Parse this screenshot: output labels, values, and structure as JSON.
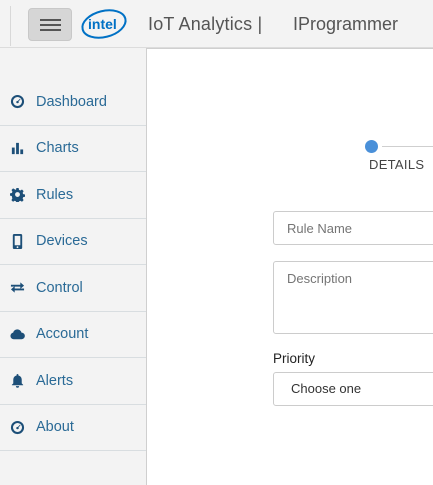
{
  "header": {
    "logo_text": "intel",
    "app_title": "IoT Analytics |",
    "account_name": "IProgrammer"
  },
  "sidebar": {
    "items": [
      {
        "label": "Dashboard",
        "icon": "dashboard-icon"
      },
      {
        "label": "Charts",
        "icon": "bar-chart-icon"
      },
      {
        "label": "Rules",
        "icon": "gear-icon"
      },
      {
        "label": "Devices",
        "icon": "mobile-device-icon"
      },
      {
        "label": "Control",
        "icon": "exchange-arrows-icon"
      },
      {
        "label": "Account",
        "icon": "cloud-icon"
      },
      {
        "label": "Alerts",
        "icon": "bell-icon"
      },
      {
        "label": "About",
        "icon": "info-icon"
      }
    ]
  },
  "wizard": {
    "step_label": "DETAILS"
  },
  "form": {
    "rule_name_placeholder": "Rule Name",
    "description_placeholder": "Description",
    "priority_label": "Priority",
    "priority_value": "Choose one"
  },
  "colors": {
    "link": "#2a6a96",
    "icon": "#1d4f78",
    "accent": "#4a90d9",
    "background": "#f3f3f3"
  }
}
